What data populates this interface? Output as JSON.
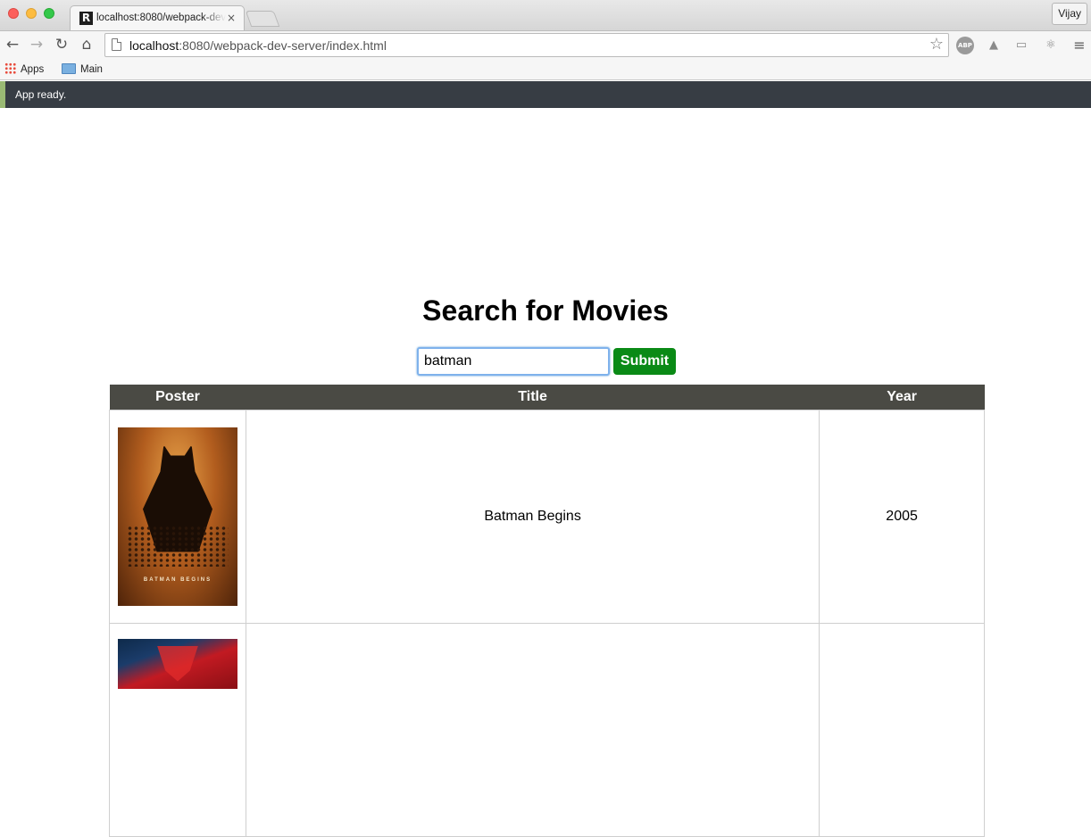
{
  "browser": {
    "tab": {
      "favicon": "R",
      "title": "localhost:8080/webpack-dev-server/index.html",
      "close_icon": "×"
    },
    "profile": "Vijay",
    "url": {
      "host": "localhost",
      "rest": ":8080/webpack-dev-server/index.html"
    },
    "bookmarks": [
      {
        "label": "Apps",
        "icon": "apps-grid-icon"
      },
      {
        "label": "Main",
        "icon": "folder-icon"
      }
    ],
    "extensions": {
      "abp": "ABP"
    }
  },
  "status": {
    "text": "App ready."
  },
  "page": {
    "heading": "Search for Movies",
    "search": {
      "value": "batman",
      "placeholder": ""
    },
    "submit_label": "Submit"
  },
  "table": {
    "headers": [
      "Poster",
      "Title",
      "Year"
    ],
    "rows": [
      {
        "title": "Batman Begins",
        "year": "2005",
        "poster_caption": "BATMAN BEGINS"
      },
      {
        "title": "",
        "year": ""
      }
    ]
  }
}
